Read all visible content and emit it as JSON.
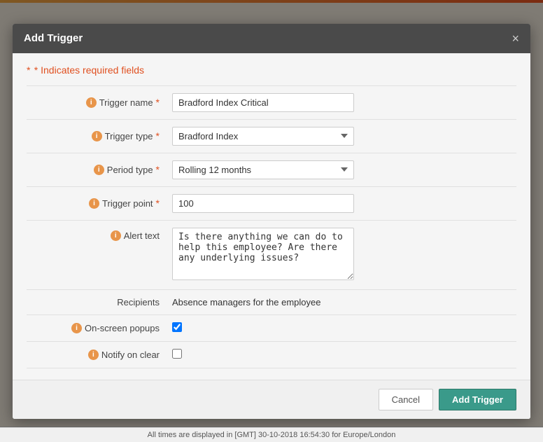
{
  "topbar": {},
  "background": {
    "sidebar_color": "#3a3030",
    "main_color": "#e8e0d4"
  },
  "modal": {
    "title": "Add Trigger",
    "close_icon": "×",
    "required_note": "* Indicates required fields",
    "required_star": "*",
    "fields": {
      "trigger_name": {
        "label": "Trigger name",
        "value": "Bradford Index Critical",
        "placeholder": "",
        "required": true
      },
      "trigger_type": {
        "label": "Trigger type",
        "value": "Bradford Index",
        "options": [
          "Bradford Index"
        ],
        "required": true
      },
      "period_type": {
        "label": "Period type",
        "value": "Rolling 12 months",
        "options": [
          "Rolling 12 months"
        ],
        "required": true
      },
      "trigger_point": {
        "label": "Trigger point",
        "value": "100",
        "placeholder": "",
        "required": true
      },
      "alert_text": {
        "label": "Alert text",
        "value": "Is there anything we can do to help this employee? Are there any underlying issues?",
        "required": false
      },
      "recipients": {
        "label": "Recipients",
        "value": "Absence managers for the employee"
      },
      "on_screen_popups": {
        "label": "On-screen popups",
        "checked": true
      },
      "notify_on_clear": {
        "label": "Notify on clear",
        "checked": false
      }
    },
    "footer": {
      "cancel_label": "Cancel",
      "add_label": "Add Trigger"
    }
  },
  "statusbar": {
    "text": "All times are displayed in [GMT] 30-10-2018 16:54:30 for Europe/London"
  }
}
